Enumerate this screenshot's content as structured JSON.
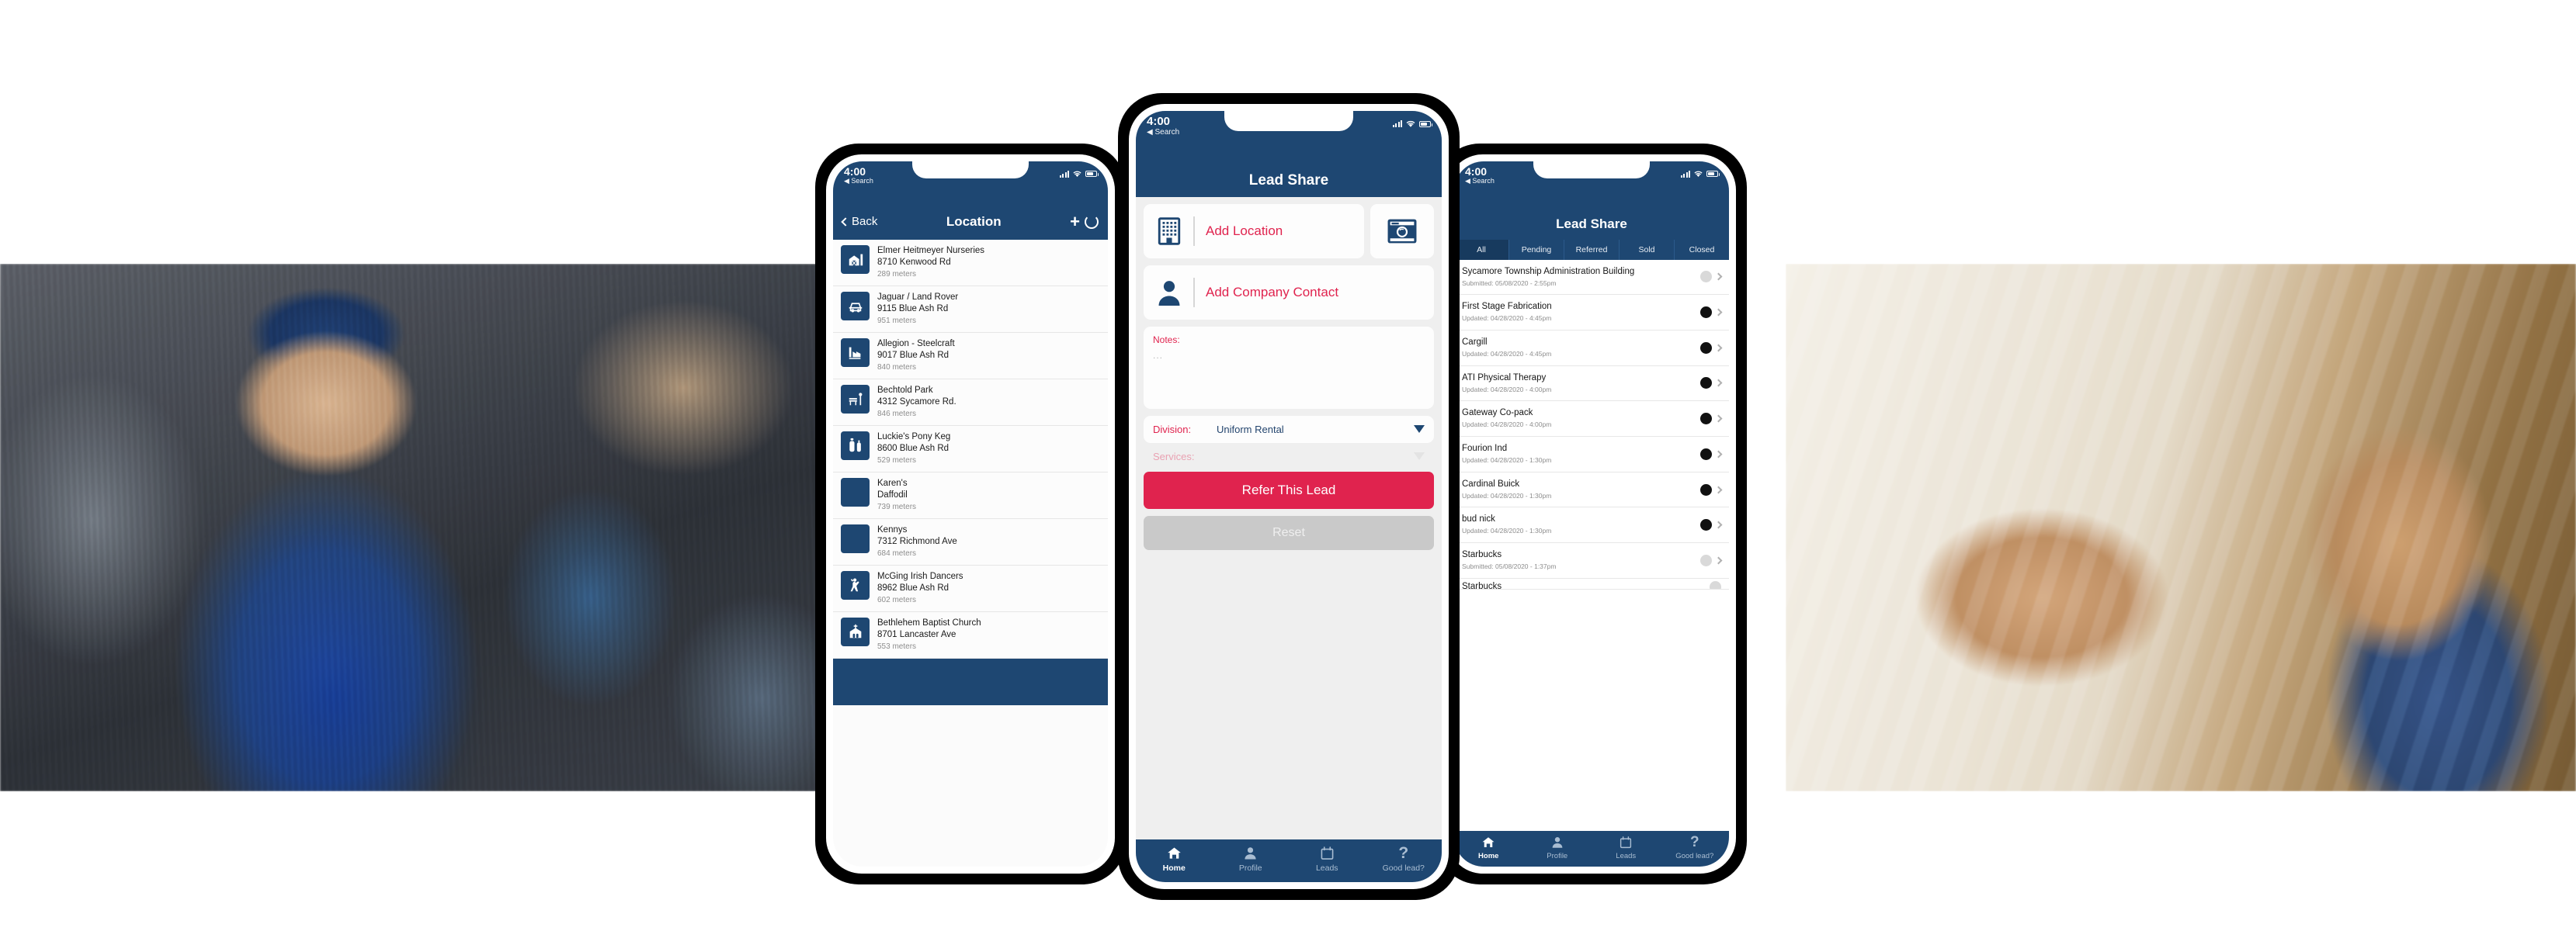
{
  "status_bar": {
    "time": "4:00",
    "back_label": "Search"
  },
  "phone_left": {
    "nav": {
      "back_label": "Back",
      "title": "Location",
      "add_icon": "plus-icon",
      "refresh_icon": "refresh-icon"
    },
    "locations": [
      {
        "name": "Elmer Heitmeyer Nurseries",
        "address": "8710 Kenwood Rd",
        "distance": "289 meters",
        "icon": "farm-icon"
      },
      {
        "name": "Jaguar / Land Rover",
        "address": "9115 Blue Ash Rd",
        "distance": "951 meters",
        "icon": "car-icon"
      },
      {
        "name": "Allegion - Steelcraft",
        "address": "9017 Blue Ash Rd",
        "distance": "840 meters",
        "icon": "factory-icon"
      },
      {
        "name": "Bechtold Park",
        "address": "4312 Sycamore Rd.",
        "distance": "846 meters",
        "icon": "park-bench-icon"
      },
      {
        "name": "Luckie's Pony Keg",
        "address": "8600 Blue Ash Rd",
        "distance": "529 meters",
        "icon": "bottle-icon"
      },
      {
        "name": "Karen's",
        "address": "Daffodil",
        "distance": "739 meters",
        "icon": "blank-icon"
      },
      {
        "name": "Kennys",
        "address": "7312 Richmond Ave",
        "distance": "684 meters",
        "icon": "blank-icon"
      },
      {
        "name": "McGing Irish Dancers",
        "address": "8962 Blue Ash Rd",
        "distance": "602 meters",
        "icon": "dancer-icon"
      },
      {
        "name": "Bethlehem Baptist Church",
        "address": "8701 Lancaster Ave",
        "distance": "553 meters",
        "icon": "church-icon"
      }
    ]
  },
  "phone_center": {
    "nav": {
      "title": "Lead Share"
    },
    "add_location_label": "Add Location",
    "add_location_icon": "building-icon",
    "camera_icon": "camera-icon",
    "add_contact_label": "Add Company Contact",
    "add_contact_icon": "person-icon",
    "notes_label": "Notes:",
    "notes_value": "...",
    "division_label": "Division:",
    "division_value": "Uniform Rental",
    "services_label": "Services:",
    "refer_button": "Refer This Lead",
    "reset_button": "Reset",
    "tabbar": [
      {
        "label": "Home",
        "icon": "home-icon",
        "active": true
      },
      {
        "label": "Profile",
        "icon": "person-icon",
        "active": false
      },
      {
        "label": "Leads",
        "icon": "calendar-icon",
        "active": false
      },
      {
        "label": "Good lead?",
        "icon": "question-icon",
        "active": false
      }
    ]
  },
  "phone_right": {
    "nav": {
      "title": "Lead Share"
    },
    "tabs": [
      {
        "label": "All",
        "active": true
      },
      {
        "label": "Pending",
        "active": false
      },
      {
        "label": "Referred",
        "active": false
      },
      {
        "label": "Sold",
        "active": false
      },
      {
        "label": "Closed",
        "active": false
      }
    ],
    "leads": [
      {
        "name": "Sycamore Township Administration Building",
        "meta": "Submitted: 05/08/2020 - 2:55pm",
        "status": "grey"
      },
      {
        "name": "First Stage Fabrication",
        "meta": "Updated: 04/28/2020 - 4:45pm",
        "status": "dark"
      },
      {
        "name": "Cargill",
        "meta": "Updated: 04/28/2020 - 4:45pm",
        "status": "dark"
      },
      {
        "name": "ATI Physical Therapy",
        "meta": "Updated: 04/28/2020 - 4:00pm",
        "status": "dark"
      },
      {
        "name": "Gateway Co-pack",
        "meta": "Updated: 04/28/2020 - 4:00pm",
        "status": "dark"
      },
      {
        "name": "Fourion Ind",
        "meta": "Updated: 04/28/2020 - 1:30pm",
        "status": "dark"
      },
      {
        "name": "Cardinal Buick",
        "meta": "Updated: 04/28/2020 - 1:30pm",
        "status": "dark"
      },
      {
        "name": "bud nick",
        "meta": "Updated: 04/28/2020 - 1:30pm",
        "status": "dark"
      },
      {
        "name": "Starbucks",
        "meta": "Submitted: 05/08/2020 - 1:37pm",
        "status": "grey"
      },
      {
        "name": "Starbucks",
        "meta": "",
        "status": "grey"
      }
    ],
    "tabbar": [
      {
        "label": "Home",
        "icon": "home-icon",
        "active": true
      },
      {
        "label": "Profile",
        "icon": "person-icon",
        "active": false
      },
      {
        "label": "Leads",
        "icon": "calendar-icon",
        "active": false
      },
      {
        "label": "Good lead?",
        "icon": "question-icon",
        "active": false
      }
    ]
  },
  "colors": {
    "navy": "#1e4772",
    "crimson": "#e0234e",
    "screen_grey": "#efefef"
  }
}
